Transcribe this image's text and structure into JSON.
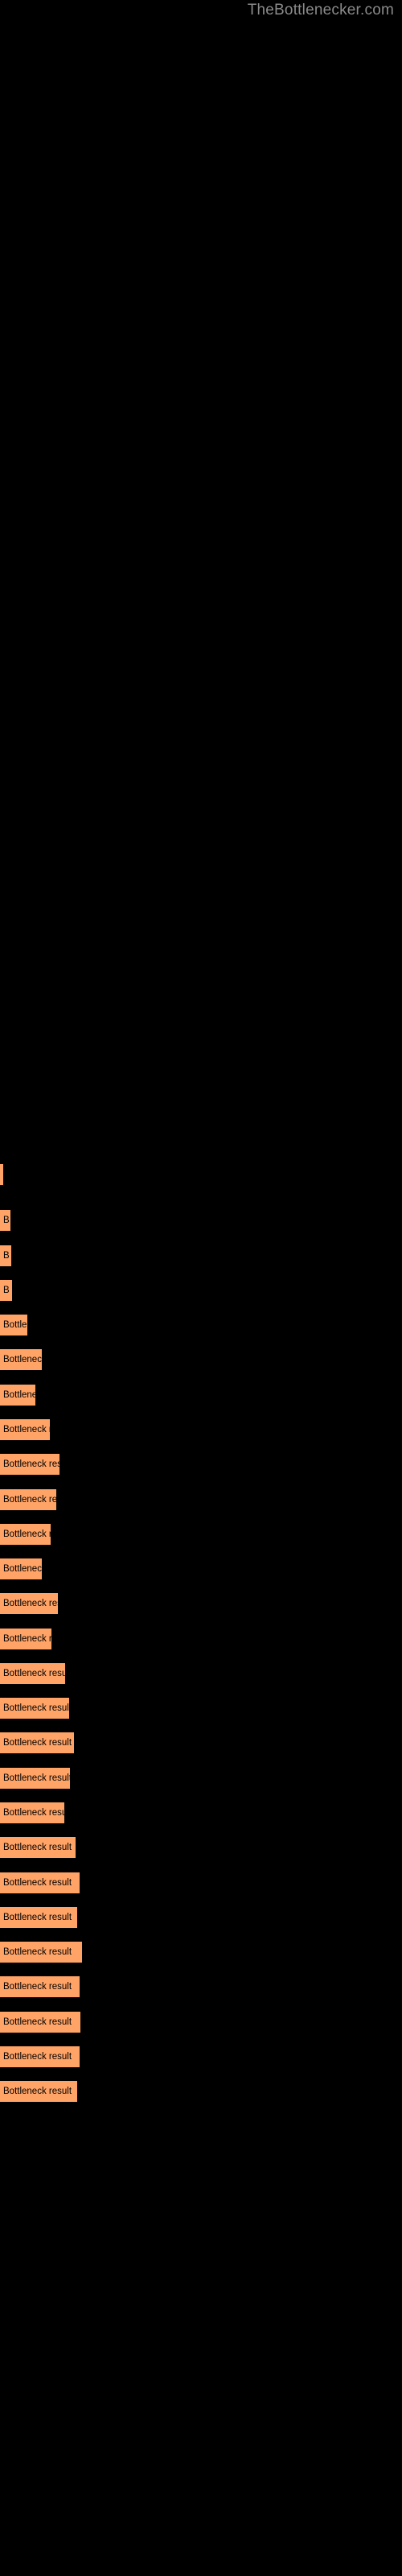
{
  "watermark": "TheBottlenecker.com",
  "chart_data": {
    "type": "bar",
    "title": "",
    "subtitle": "",
    "xlabel": "",
    "ylabel": "",
    "orientation": "horizontal",
    "grid": false,
    "legend": false,
    "background": "#000000",
    "bar_color": "#ffa366",
    "label_color": "#000000",
    "xlim": [
      0,
      500
    ],
    "categories": [
      "",
      "",
      "",
      "",
      "",
      "",
      "",
      "",
      "",
      "",
      "",
      "",
      "",
      "",
      "",
      "",
      "",
      "",
      "",
      "",
      "",
      "",
      "",
      "",
      "",
      "",
      ""
    ],
    "values": [
      4,
      13,
      14,
      15,
      34,
      52,
      44,
      62,
      74,
      70,
      63,
      52,
      72,
      64,
      81,
      86,
      92,
      87,
      80,
      94,
      99,
      96,
      102,
      99,
      100,
      99,
      96
    ],
    "bar_labels": [
      "",
      "B",
      "B",
      "B",
      "Bottler",
      "Bottleneck",
      "Bottlene",
      "Bottleneck re",
      "Bottleneck resul",
      "Bottleneck re",
      "Bottleneck res",
      "Bottleneck",
      "Bottleneck result",
      "Bottleneck re",
      "Bottleneck result",
      "Bottleneck result",
      "Bottleneck result",
      "Bottleneck result",
      "Bottleneck result",
      "Bottleneck result",
      "Bottleneck result",
      "Bottleneck result",
      "Bottleneck result",
      "Bottleneck result",
      "Bottleneck result",
      "Bottleneck result",
      "Bottleneck result"
    ],
    "bar_tops": [
      1446,
      1503,
      1547,
      1590,
      1633,
      1676,
      1720,
      1763,
      1806,
      1850,
      1893,
      1936,
      1979,
      2023,
      2066,
      2109,
      2152,
      2196,
      2239,
      2282,
      2326,
      2369,
      2412,
      2455,
      2499,
      2542,
      2585
    ]
  }
}
